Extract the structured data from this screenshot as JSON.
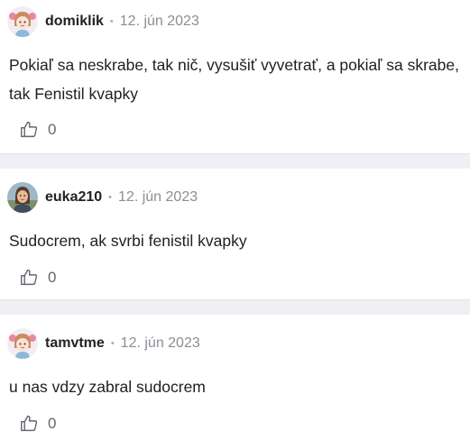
{
  "comments": [
    {
      "username": "domiklik",
      "separator": "•",
      "date": "12. jún 2023",
      "avatar_icon": "girl-cartoon-avatar",
      "text": "Pokiaľ sa neskrabe, tak nič, vysušiť vyvetrať, a pokiaľ sa skrabe, tak Fenistil kvapky",
      "likes": "0"
    },
    {
      "username": "euka210",
      "separator": "•",
      "date": "12. jún 2023",
      "avatar_icon": "user-photo-avatar",
      "text": "Sudocrem, ak svrbi fenistil kvapky",
      "likes": "0"
    },
    {
      "username": "tamvtme",
      "separator": "•",
      "date": "12. jún 2023",
      "avatar_icon": "girl-cartoon-avatar",
      "text": "u nas vdzy zabral sudocrem",
      "likes": "0"
    }
  ],
  "colors": {
    "divider": "#f0eff4",
    "username": "#222222",
    "date": "#8d8d96",
    "text": "#1f1f1f",
    "like_icon": "#666670"
  }
}
